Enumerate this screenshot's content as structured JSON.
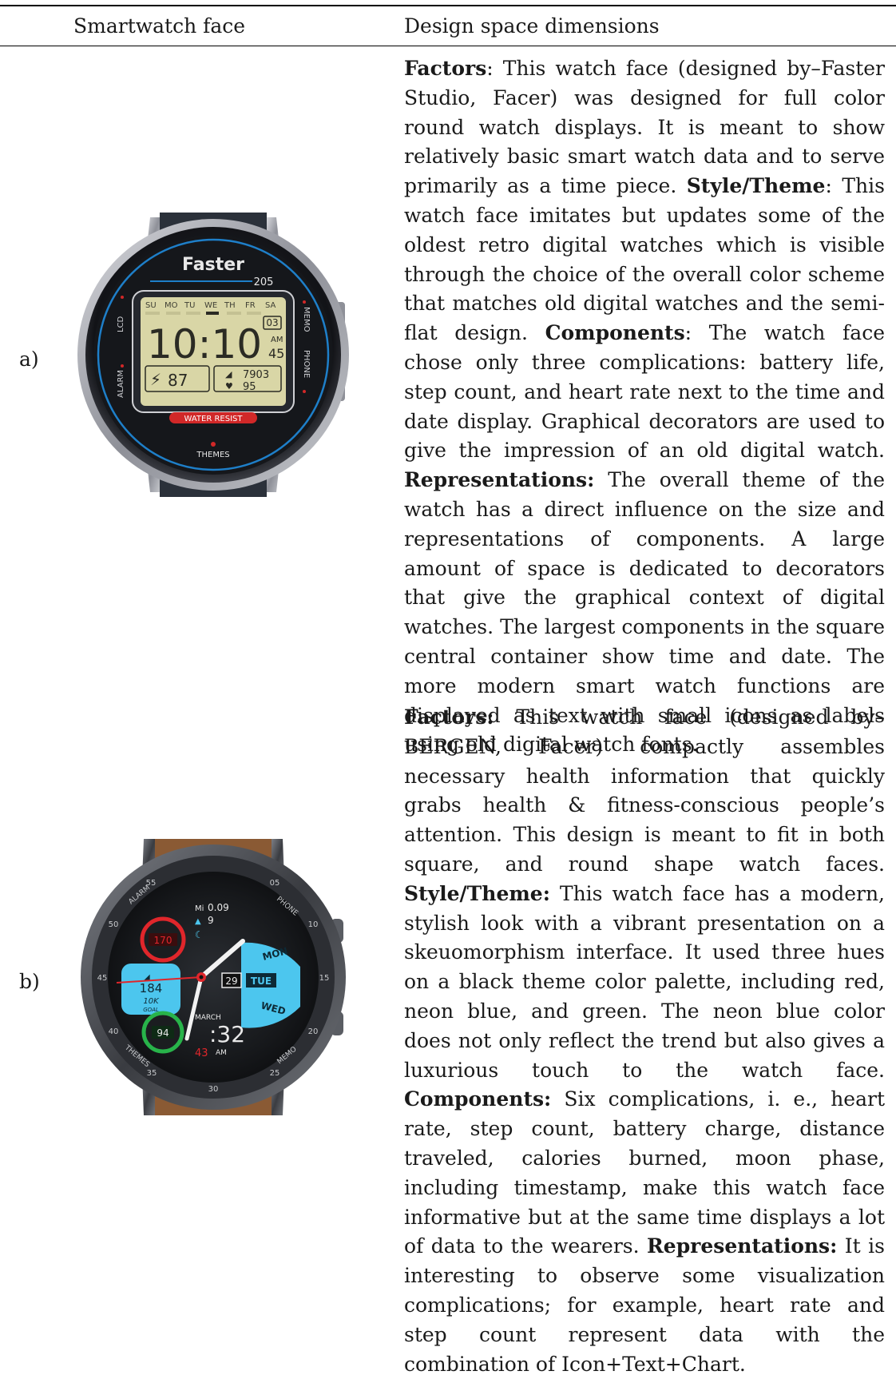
{
  "table": {
    "headers": [
      "Smartwatch face",
      "Design space dimensions"
    ],
    "rows": [
      {
        "label": "a)",
        "watch": {
          "brand": "Faster",
          "model": "205",
          "days": [
            "SU",
            "MO",
            "TU",
            "WE",
            "TH",
            "FR",
            "SA"
          ],
          "date": "03",
          "time": "10:10",
          "ampm": "AM",
          "seconds": "45",
          "battery": "87",
          "steps": "7903",
          "heart_rate": "95",
          "left_labels": [
            "LCD",
            "ALARM"
          ],
          "right_labels": [
            "MEMO",
            "PHONE"
          ],
          "badge": "WATER RESIST",
          "bottom_label": "THEMES",
          "colors": {
            "bezel": "#1b1c20",
            "lcd": "#d9d6a6",
            "blue": "#1e7fc9",
            "red": "#d12828"
          }
        },
        "segments": [
          {
            "text": "Factors",
            "bold": true
          },
          {
            "text": ": This watch face (designed by–Faster Stu­dio, Facer) was designed for full color round watch displays. It is meant to show relatively basic smart watch data and to serve primarily as a time piece. ",
            "bold": false
          },
          {
            "text": "Style/Theme",
            "bold": true
          },
          {
            "text": ": This watch face imitates but updates some of the oldest retro digital watches which is vis­ible through the choice of the overall color scheme that matches old digital watches and the semi-flat de­sign. ",
            "bold": false
          },
          {
            "text": "Components",
            "bold": true
          },
          {
            "text": ": The watch face chose only three complications: battery life, step count, and heart rate next to the time and date display. Graphical decora­tors are used to give the impression of an old digital watch. ",
            "bold": false
          },
          {
            "text": "Representations:",
            "bold": true
          },
          {
            "text": " The overall theme of the watch has a direct influence on the size and represen­tations of components. A large amount of space is dedicated to decorators that give the graphical con­text of digital watches. The largest components in the square central container show time and date. The more modern smart watch functions are displayed as text with small icons as labels using old digital watch fonts.",
            "bold": false
          }
        ]
      },
      {
        "label": "b)",
        "watch": {
          "distance_unit": "Mi",
          "distance": "0.09",
          "calories": "9",
          "heart_rate": "170",
          "steps": "184",
          "goal": "10K",
          "goal_label": "GOAL",
          "battery": "94",
          "date": "29",
          "days": [
            "MON",
            "TUE",
            "WED"
          ],
          "month": "MARCH",
          "time": ":32",
          "seconds": "43",
          "ampm": "AM",
          "bezel_numbers": [
            "55",
            "05",
            "10",
            "15",
            "20",
            "25",
            "30",
            "35",
            "40",
            "45",
            "50"
          ],
          "bezel_labels": [
            "ALARM",
            "PHONE",
            "MEMO",
            "THEMES"
          ],
          "colors": {
            "neon": "#4cc6ee",
            "red": "#e0262b",
            "green": "#28b34a",
            "strap": "#8a5a34"
          }
        },
        "segments": [
          {
            "text": "Factors:",
            "bold": true
          },
          {
            "text": " This watch face (designed by–BERGEN, Facer) compactly assembles necessary health infor­mation that quickly grabs health & fitness-conscious people’s attention. This design is meant to fit in both square, and round shape watch faces. ",
            "bold": false
          },
          {
            "text": "Style/Theme:",
            "bold": true
          },
          {
            "text": " This watch face has a modern, stylish look with a vibrant presentation on a skeuomorphism interface. It used three hues on a black theme color palette, including red, neon blue, and green. The neon blue color does not only reflect the trend but also gives a luxurious touch to the watch face. ",
            "bold": false
          },
          {
            "text": "Components:",
            "bold": true
          },
          {
            "text": " Six complications, i. e., heart rate, step count, bat­tery charge, distance traveled, calories burned, moon phase, including timestamp, make this watch face informative but at the same time displays a lot of data to the wearers. ",
            "bold": false
          },
          {
            "text": "Representations:",
            "bold": true
          },
          {
            "text": " It is interest­ing to observe some visualization complications; for example, heart rate and step count represent data with the combination of Icon+Text+Chart.",
            "bold": false
          }
        ]
      }
    ]
  }
}
